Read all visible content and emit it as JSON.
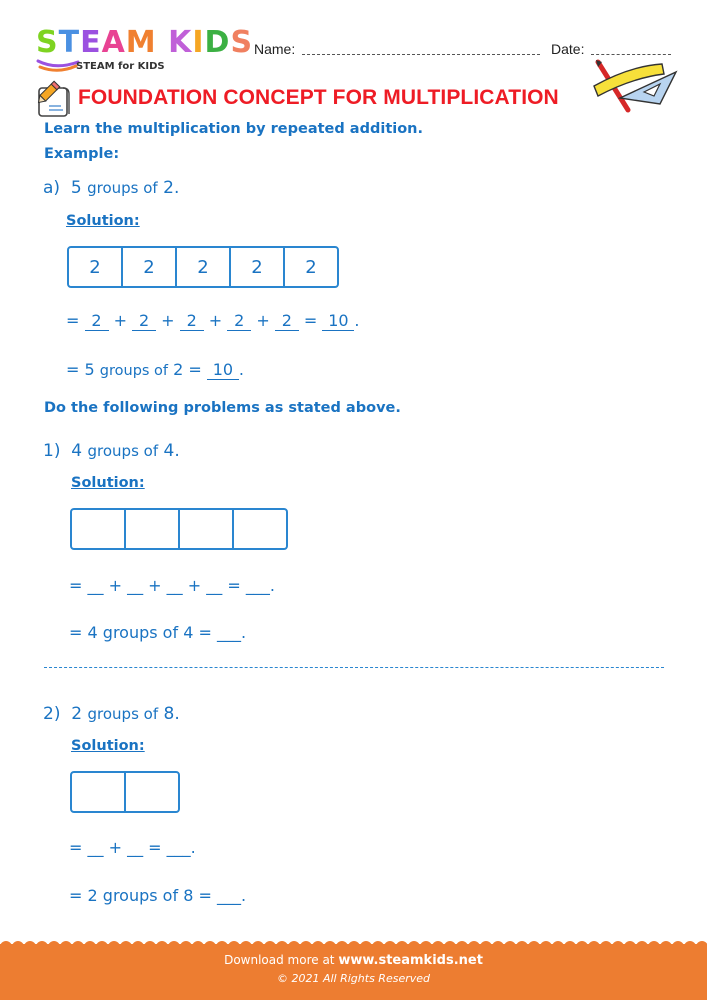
{
  "logo": {
    "letters": [
      {
        "ch": "S",
        "color": "#7ed321"
      },
      {
        "ch": "T",
        "color": "#4a90e2"
      },
      {
        "ch": "E",
        "color": "#9b51e0"
      },
      {
        "ch": "A",
        "color": "#e84393"
      },
      {
        "ch": "M",
        "color": "#f08030"
      },
      {
        "ch": " ",
        "color": "#ffffff"
      },
      {
        "ch": "K",
        "color": "#c060d8"
      },
      {
        "ch": "I",
        "color": "#f5a623"
      },
      {
        "ch": "D",
        "color": "#3cb043"
      },
      {
        "ch": "S",
        "color": "#f08060"
      }
    ],
    "subtitle": "STEAM for KIDS"
  },
  "header": {
    "name_label": "Name:",
    "date_label": "Date:"
  },
  "title": "FOUNDATION CONCEPT FOR MULTIPLICATION",
  "icons": {
    "title_icon": "pencil-paper-icon",
    "tools_icon": "ruler-triangle-pencil-icon"
  },
  "intro": {
    "instruction": "Learn the multiplication by repeated addition.",
    "example_label": "Example:"
  },
  "example": {
    "label": "a)",
    "groups": "5",
    "groups_text": "groups of",
    "size": "2",
    "end": ".",
    "solution_label": "Solution:",
    "boxes": [
      "2",
      "2",
      "2",
      "2",
      "2"
    ],
    "addends": [
      "2",
      "2",
      "2",
      "2",
      "2"
    ],
    "sum": "10",
    "statement_groups": "5",
    "statement_text": "groups of",
    "statement_size": "2",
    "statement_result": "10"
  },
  "instruction2": "Do the following problems as stated above.",
  "problems": [
    {
      "label": "1)",
      "groups": "4",
      "groups_text": "groups of",
      "size": "4",
      "solution_label": "Solution:",
      "box_count": 4,
      "addend_blank": "__",
      "sum_blank": "___",
      "statement_groups": "4",
      "statement_text": "groups of",
      "statement_size": "4",
      "statement_blank": "___"
    },
    {
      "label": "2)",
      "groups": "2",
      "groups_text": "groups of",
      "size": "8",
      "solution_label": "Solution:",
      "box_count": 2,
      "addend_blank": "__",
      "sum_blank": "___",
      "statement_groups": "2",
      "statement_text": "groups of",
      "statement_size": "8",
      "statement_blank": "___"
    }
  ],
  "footer": {
    "download_text": "Download more at",
    "url": "www.steamkids.net",
    "copyright": "© 2021 All Rights Reserved",
    "color": "#ed7d31"
  }
}
